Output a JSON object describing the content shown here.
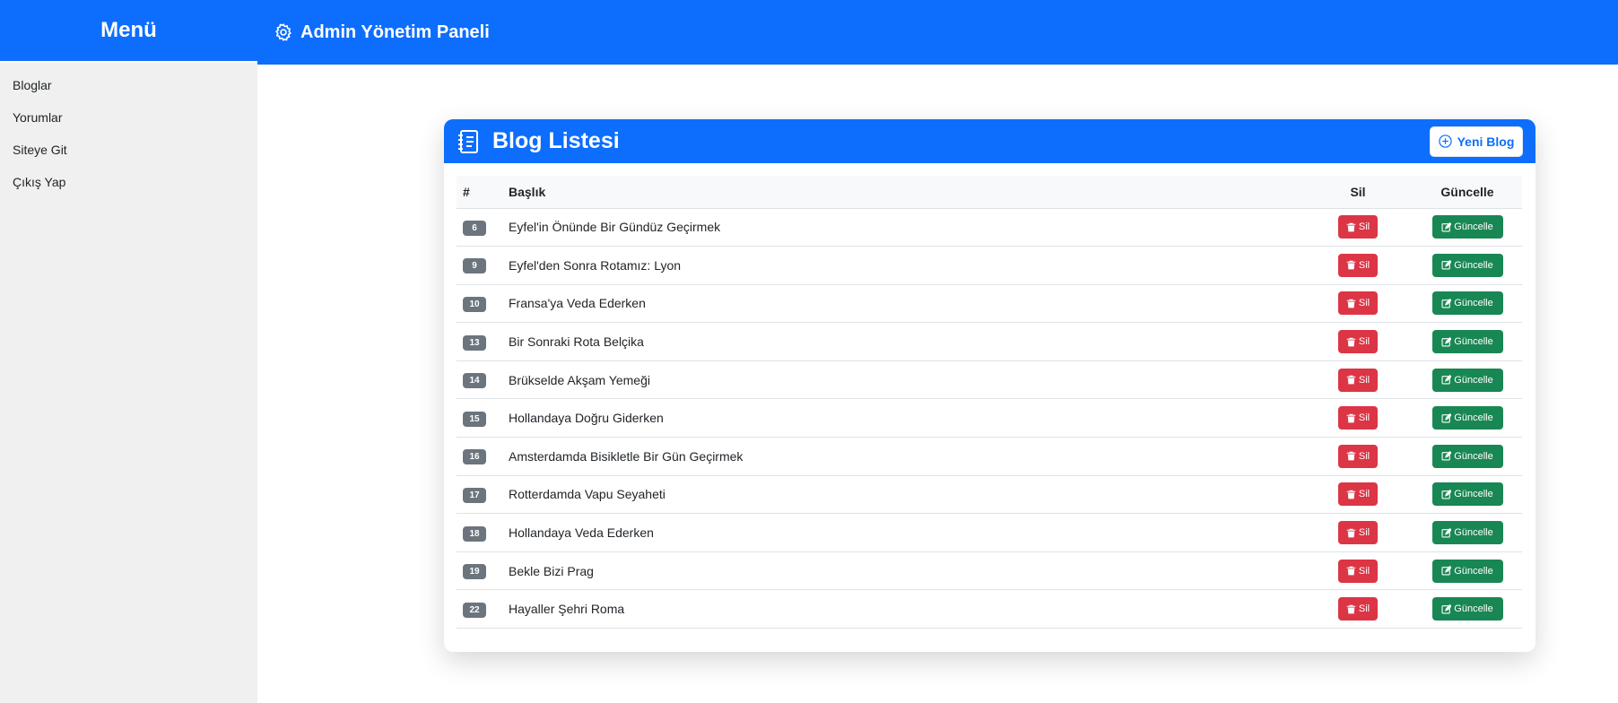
{
  "sidebar": {
    "title": "Menü",
    "items": [
      {
        "label": "Bloglar"
      },
      {
        "label": "Yorumlar"
      },
      {
        "label": "Siteye Git"
      },
      {
        "label": "Çıkış Yap"
      }
    ]
  },
  "topbar": {
    "title": "Admin Yönetim Paneli",
    "icon": "gear-icon"
  },
  "card": {
    "title": "Blog Listesi",
    "icon": "journal-icon",
    "new_button_label": "Yeni Blog",
    "columns": {
      "num": "#",
      "title": "Başlık",
      "delete": "Sil",
      "update": "Güncelle"
    },
    "delete_label": "Sil",
    "update_label": "Güncelle",
    "rows": [
      {
        "id": "6",
        "title": "Eyfel'in Önünde Bir Gündüz Geçirmek"
      },
      {
        "id": "9",
        "title": "Eyfel'den Sonra Rotamız: Lyon"
      },
      {
        "id": "10",
        "title": "Fransa'ya Veda Ederken"
      },
      {
        "id": "13",
        "title": "Bir Sonraki Rota Belçika"
      },
      {
        "id": "14",
        "title": "Brükselde Akşam Yemeği"
      },
      {
        "id": "15",
        "title": "Hollandaya Doğru Giderken"
      },
      {
        "id": "16",
        "title": "Amsterdamda Bisikletle Bir Gün Geçirmek"
      },
      {
        "id": "17",
        "title": "Rotterdamda Vapu Seyaheti"
      },
      {
        "id": "18",
        "title": "Hollandaya Veda Ederken"
      },
      {
        "id": "19",
        "title": "Bekle Bizi Prag"
      },
      {
        "id": "22",
        "title": "Hayaller Şehri Roma"
      }
    ]
  },
  "colors": {
    "primary": "#0d6efd",
    "danger": "#dc3545",
    "success": "#198754",
    "badge": "#6c757d",
    "sidebar_bg": "#f0f0f0"
  }
}
